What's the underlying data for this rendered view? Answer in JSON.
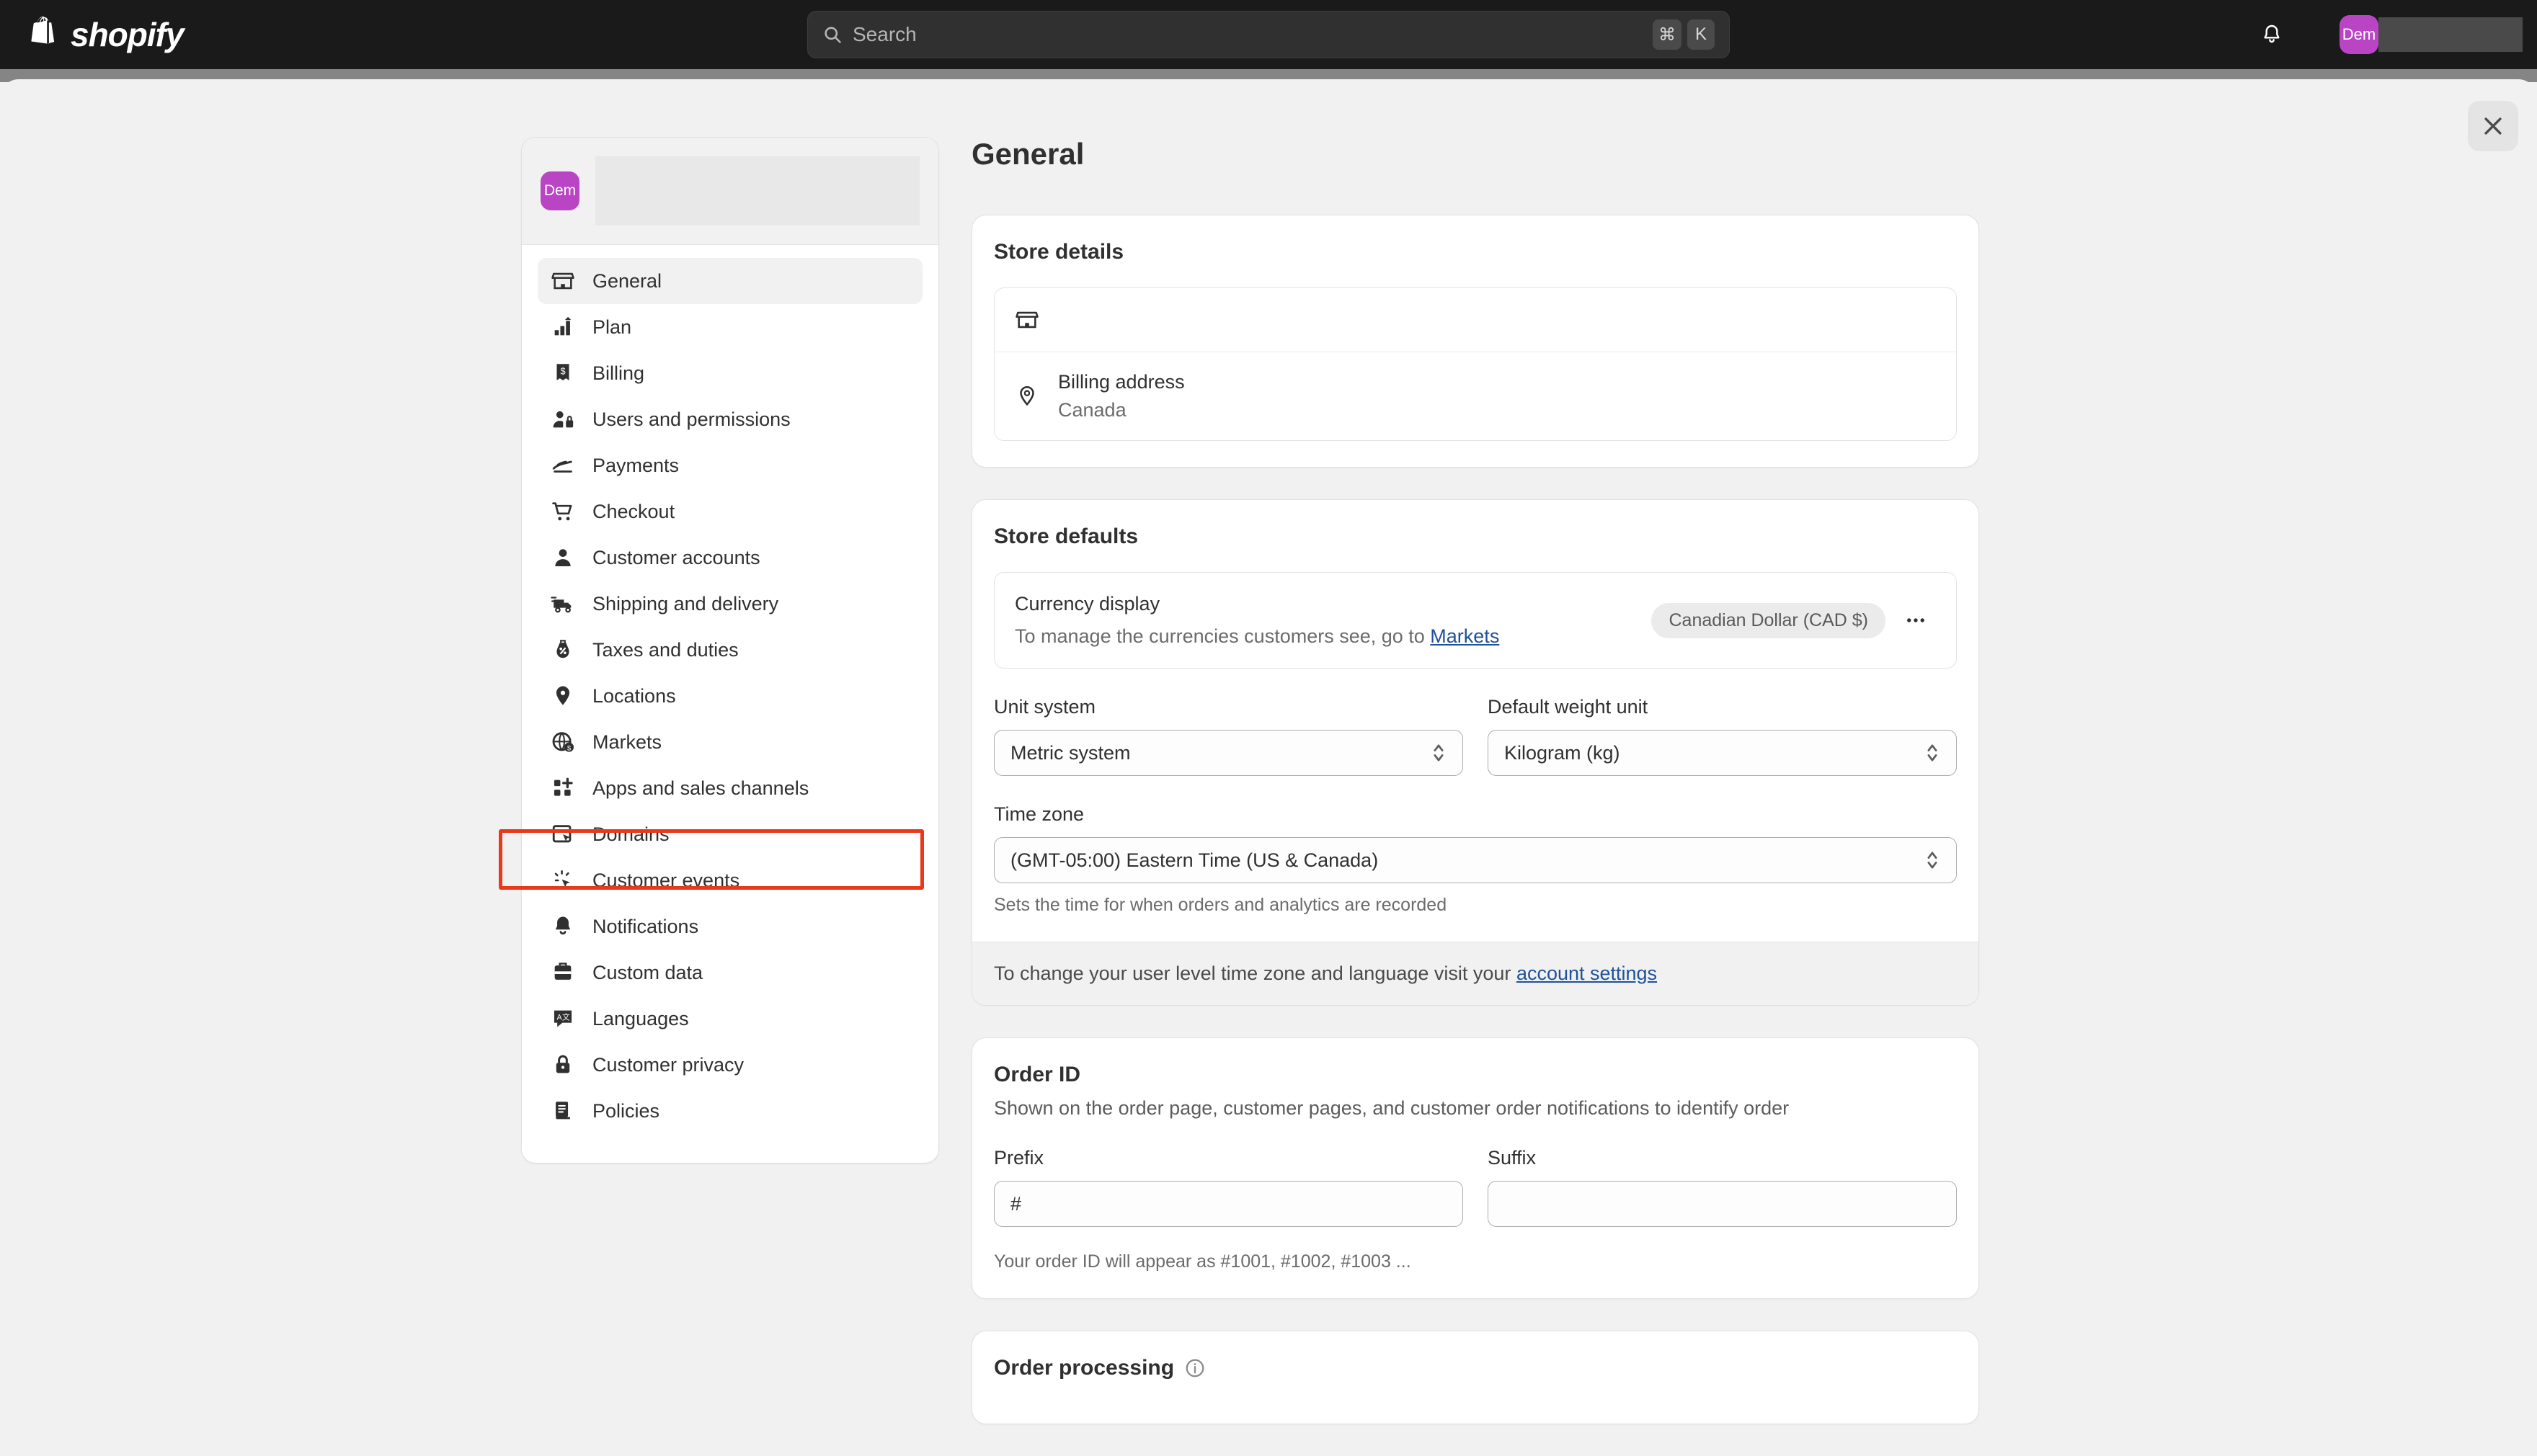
{
  "topbar": {
    "brand": "shopify",
    "search": {
      "placeholder": "Search",
      "key_mod": "⌘",
      "key_letter": "K"
    },
    "avatar_initials": "Dem"
  },
  "sidebar": {
    "avatar_initials": "Dem",
    "items": [
      {
        "label": "General",
        "icon": "store-icon",
        "active": true
      },
      {
        "label": "Plan",
        "icon": "chart-rocket-icon",
        "active": false
      },
      {
        "label": "Billing",
        "icon": "receipt-dollar-icon",
        "active": false
      },
      {
        "label": "Users and permissions",
        "icon": "user-lock-icon",
        "active": false
      },
      {
        "label": "Payments",
        "icon": "payment-card-icon",
        "active": false
      },
      {
        "label": "Checkout",
        "icon": "cart-icon",
        "active": false
      },
      {
        "label": "Customer accounts",
        "icon": "person-icon",
        "active": false
      },
      {
        "label": "Shipping and delivery",
        "icon": "delivery-truck-icon",
        "active": false
      },
      {
        "label": "Taxes and duties",
        "icon": "tax-bag-icon",
        "active": false
      },
      {
        "label": "Locations",
        "icon": "location-pin-icon",
        "active": false
      },
      {
        "label": "Markets",
        "icon": "globe-dollar-icon",
        "active": false
      },
      {
        "label": "Apps and sales channels",
        "icon": "apps-grid-plus-icon",
        "active": false
      },
      {
        "label": "Domains",
        "icon": "domain-cursor-icon",
        "active": false
      },
      {
        "label": "Customer events",
        "icon": "click-event-icon",
        "active": false
      },
      {
        "label": "Notifications",
        "icon": "bell-icon",
        "active": false
      },
      {
        "label": "Custom data",
        "icon": "database-icon",
        "active": false
      },
      {
        "label": "Languages",
        "icon": "translate-icon",
        "active": false
      },
      {
        "label": "Customer privacy",
        "icon": "lock-icon",
        "active": false
      },
      {
        "label": "Policies",
        "icon": "policy-document-icon",
        "active": false
      }
    ]
  },
  "highlight": {
    "target_label": "Apps and sales channels",
    "color": "#e8391a"
  },
  "main": {
    "title": "General",
    "store_details": {
      "heading": "Store details",
      "billing_label": "Billing address",
      "billing_value": "Canada"
    },
    "store_defaults": {
      "heading": "Store defaults",
      "currency_label": "Currency display",
      "currency_help_prefix": "To manage the currencies customers see, go to ",
      "currency_help_link": "Markets",
      "currency_badge": "Canadian Dollar (CAD $)",
      "unit_system_label": "Unit system",
      "unit_system_value": "Metric system",
      "weight_unit_label": "Default weight unit",
      "weight_unit_value": "Kilogram (kg)",
      "timezone_label": "Time zone",
      "timezone_value": "(GMT-05:00) Eastern Time (US & Canada)",
      "timezone_helper": "Sets the time for when orders and analytics are recorded",
      "footer_prefix": "To change your user level time zone and language visit your ",
      "footer_link": "account settings"
    },
    "order_id": {
      "heading": "Order ID",
      "description": "Shown on the order page, customer pages, and customer order notifications to identify order",
      "prefix_label": "Prefix",
      "prefix_value": "#",
      "suffix_label": "Suffix",
      "suffix_value": "",
      "helper": "Your order ID will appear as #1001, #1002, #1003 ..."
    },
    "order_processing": {
      "heading": "Order processing"
    }
  },
  "colors": {
    "brand_magenta": "#b945c5",
    "link_blue": "#1f5199",
    "highlight_red": "#e8391a"
  }
}
